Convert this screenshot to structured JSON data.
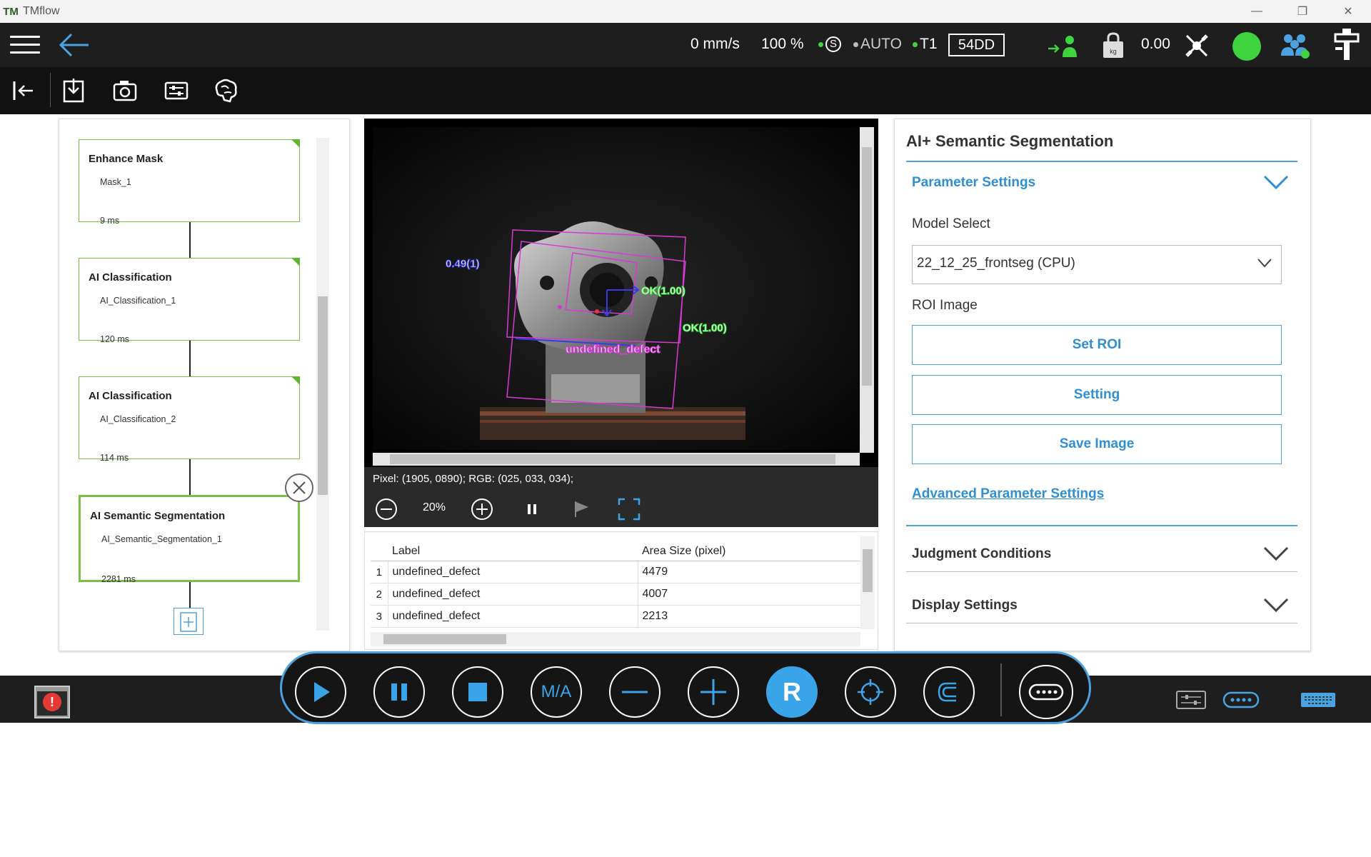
{
  "window": {
    "title": "TMflow",
    "logo_text": "TM"
  },
  "status": {
    "speed": "0 mm/s",
    "percent": "100 %",
    "safety": "S",
    "mode": "AUTO",
    "stage": "T1",
    "code": "54DD",
    "payload": "0.00",
    "payload_unit": "kg"
  },
  "flow": {
    "nodes": [
      {
        "title": "Enhance Mask",
        "subtitle": "Mask_1",
        "time": "9 ms"
      },
      {
        "title": "AI Classification",
        "subtitle": "AI_Classification_1",
        "time": "120 ms"
      },
      {
        "title": "AI Classification",
        "subtitle": "AI_Classification_2",
        "time": "114 ms"
      },
      {
        "title": "AI Semantic Segmentation",
        "subtitle": "AI_Semantic_Segmentation_1",
        "time": "2281 ms"
      }
    ]
  },
  "viewer": {
    "overlay_labels": {
      "left": "0.49(1)",
      "ok1": "OK(1.00)",
      "ok2": "OK(1.00)",
      "defect": "undefined_defect"
    },
    "pixel_info": "Pixel: (1905, 0890); RGB: (025, 033, 034);",
    "zoom": "20%"
  },
  "results": {
    "headers": [
      "Label",
      "Area Size (pixel)"
    ],
    "rows": [
      {
        "idx": "1",
        "label": "undefined_defect",
        "area": "4479"
      },
      {
        "idx": "2",
        "label": "undefined_defect",
        "area": "4007"
      },
      {
        "idx": "3",
        "label": "undefined_defect",
        "area": "2213"
      }
    ]
  },
  "settings": {
    "title": "AI+ Semantic Segmentation",
    "parameter_settings": "Parameter Settings",
    "model_select_label": "Model Select",
    "model_value": "22_12_25_frontseg (CPU)",
    "roi_image_label": "ROI Image",
    "buttons": {
      "set_roi": "Set ROI",
      "setting": "Setting",
      "save_image": "Save Image"
    },
    "advanced": "Advanced Parameter Settings",
    "judgment": "Judgment Conditions",
    "display": "Display Settings"
  },
  "controls": {
    "ma_label": "M/A",
    "r_label": "R"
  },
  "colors": {
    "accent": "#4aa3df",
    "node_green": "#7ac043",
    "overlay_magenta": "#d63ad6",
    "overlay_green": "#3fe53f",
    "status_green": "#3fd33f"
  }
}
